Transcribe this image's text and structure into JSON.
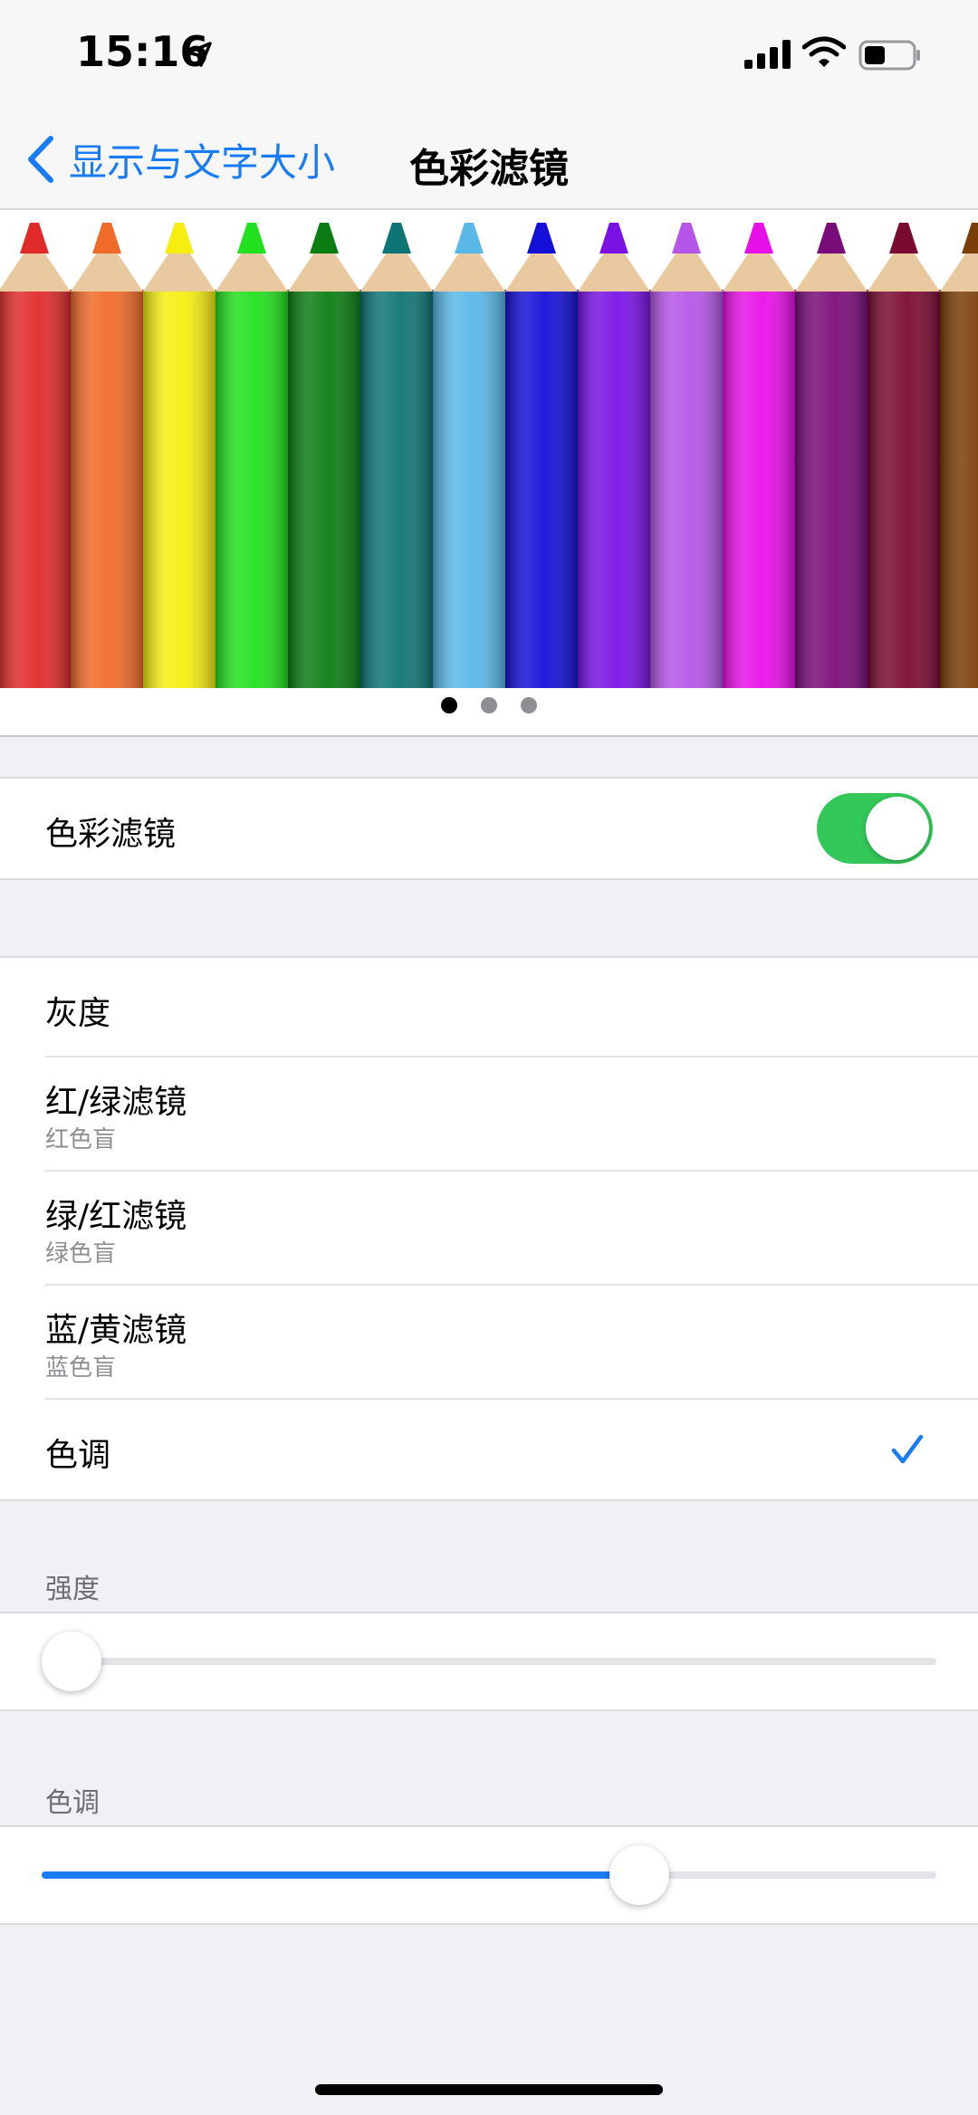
{
  "status_bar": {
    "time": "15:16"
  },
  "nav": {
    "back_label": "显示与文字大小",
    "title": "色彩滤镜"
  },
  "banner": {
    "pencil_colors": [
      "#e12a2a",
      "#f06a2a",
      "#f5ee10",
      "#22e01e",
      "#0b7d12",
      "#0e7575",
      "#5ab8e8",
      "#1410d8",
      "#7a12e6",
      "#b656e8",
      "#e810e8",
      "#7a0c7a",
      "#7a0a32",
      "#7a3e08"
    ],
    "page_count": 3,
    "active_page": 0
  },
  "color_filters_switch": {
    "label": "色彩滤镜",
    "on": true
  },
  "filters": {
    "selected": "色调",
    "items": [
      {
        "label": "灰度",
        "sub": ""
      },
      {
        "label": "红/绿滤镜",
        "sub": "红色盲"
      },
      {
        "label": "绿/红滤镜",
        "sub": "绿色盲"
      },
      {
        "label": "蓝/黄滤镜",
        "sub": "蓝色盲"
      },
      {
        "label": "色调",
        "sub": ""
      }
    ]
  },
  "intensity": {
    "header": "强度",
    "value": 0.0
  },
  "hue": {
    "header": "色调",
    "value": 0.68
  },
  "colors": {
    "accent": "#1a7cf5",
    "switch_on": "#34c759",
    "background": "#f0f0f5"
  }
}
